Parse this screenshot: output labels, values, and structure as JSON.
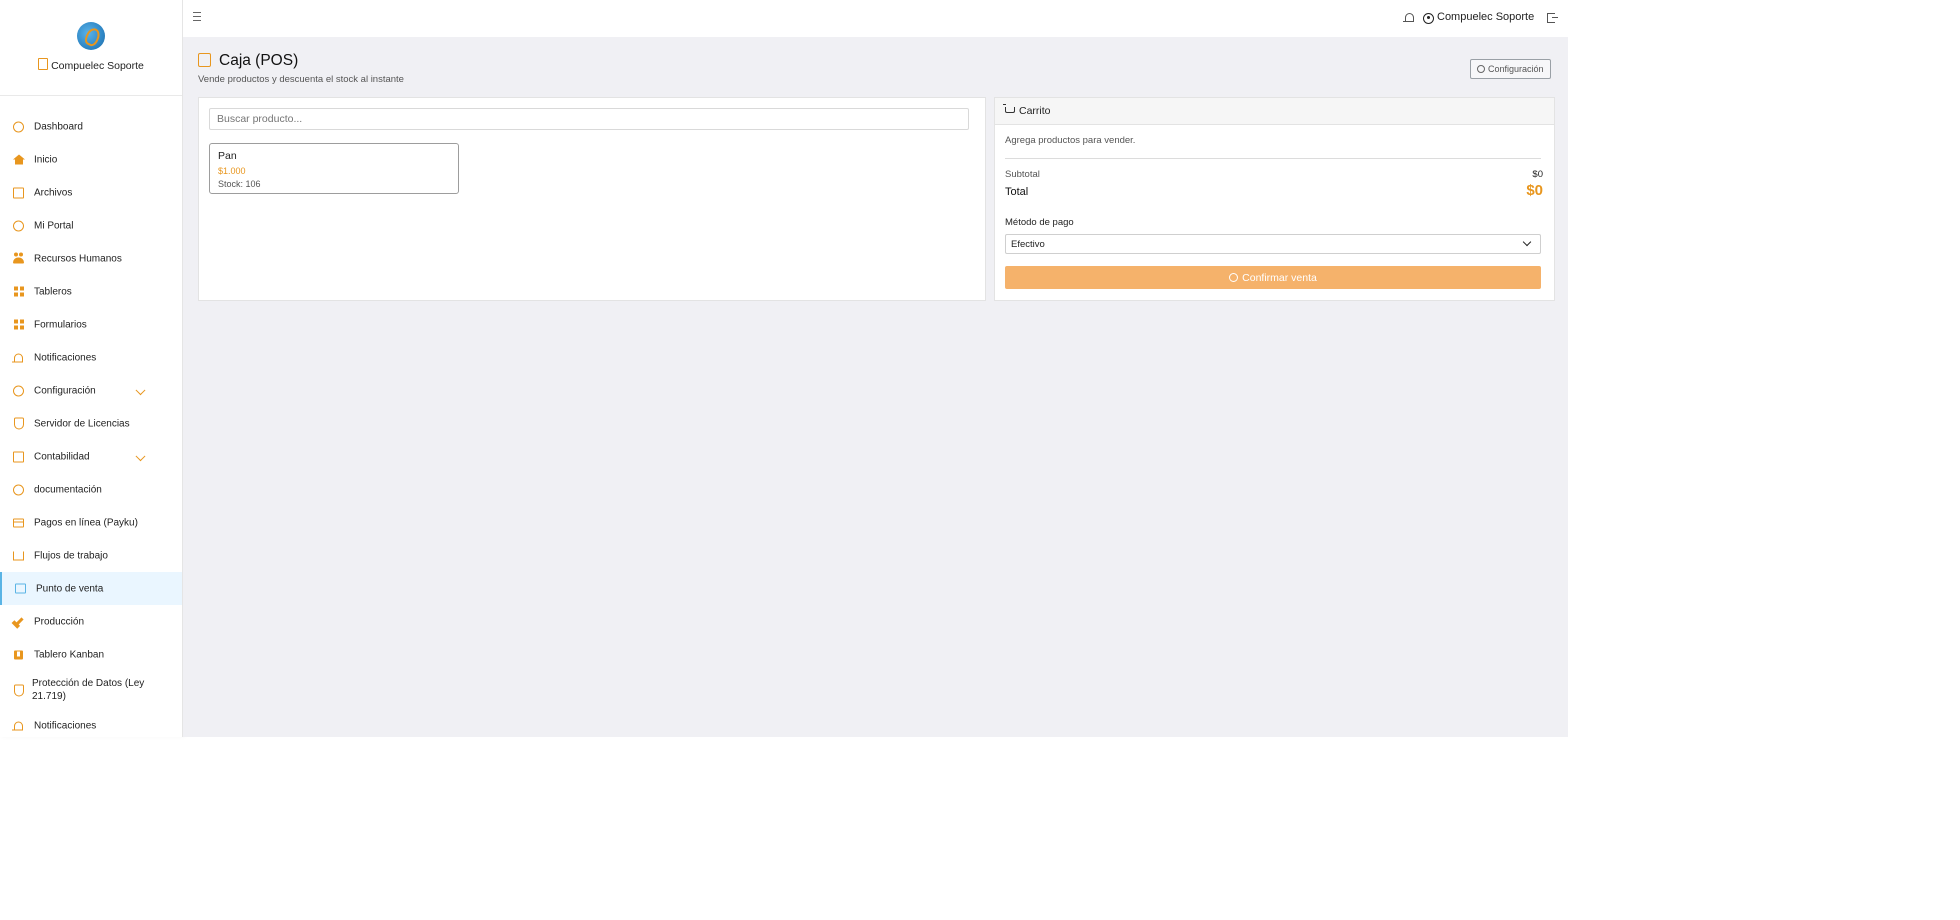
{
  "brand": {
    "name": "Compuelec Soporte"
  },
  "sidebar": {
    "items": [
      {
        "label": "Dashboard"
      },
      {
        "label": "Inicio"
      },
      {
        "label": "Archivos"
      },
      {
        "label": "Mi Portal"
      },
      {
        "label": "Recursos Humanos"
      },
      {
        "label": "Tableros"
      },
      {
        "label": "Formularios"
      },
      {
        "label": "Notificaciones"
      },
      {
        "label": "Configuración"
      },
      {
        "label": "Servidor de Licencias"
      },
      {
        "label": "Contabilidad"
      },
      {
        "label": "documentación"
      },
      {
        "label": "Pagos en línea (Payku)"
      },
      {
        "label": "Flujos de trabajo"
      },
      {
        "label": "Punto de venta"
      },
      {
        "label": "Producción"
      },
      {
        "label": "Tablero Kanban"
      },
      {
        "label": "Protección de Datos (Ley 21.719)"
      },
      {
        "label": "Notificaciones"
      }
    ],
    "active": "Punto de venta"
  },
  "topbar": {
    "user_name": "Compuelec Soporte"
  },
  "page": {
    "title": "Caja (POS)",
    "subtitle": "Vende productos y descuenta el stock al instante",
    "config_button": "Configuración"
  },
  "search": {
    "placeholder": "Buscar producto..."
  },
  "products": [
    {
      "name": "Pan",
      "price": "$1.000",
      "stock": "Stock: 106"
    }
  ],
  "cart": {
    "title": "Carrito",
    "empty_text": "Agrega productos para vender.",
    "subtotal_label": "Subtotal",
    "subtotal_value": "$0",
    "total_label": "Total",
    "total_value": "$0",
    "payment_label": "Método de pago",
    "payment_value": "Efectivo",
    "confirm_label": "Confirmar venta"
  },
  "colors": {
    "accent": "#e8961e",
    "active_bg": "#eaf6ff",
    "confirm_bg": "#f5b26b",
    "main_bg": "#f0f0f4"
  }
}
